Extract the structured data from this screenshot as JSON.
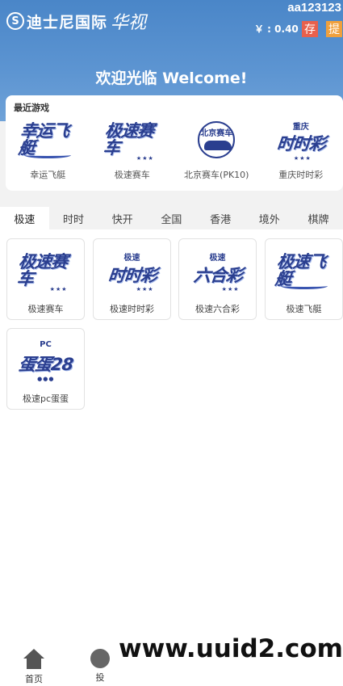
{
  "header": {
    "logo_mark": "S",
    "logo_text": "迪士尼国际",
    "logo_script": "华视",
    "username": "aa123123",
    "balance": "￥ : 0.40",
    "deposit_label": "存",
    "withdraw_label": "提",
    "welcome": "欢迎光临 Welcome!"
  },
  "recent": {
    "title": "最近游戏",
    "items": [
      {
        "label": "幸运飞艇",
        "logo": "幸运飞艇"
      },
      {
        "label": "极速赛车",
        "logo": "极速赛车"
      },
      {
        "label": "北京赛车(PK10)",
        "logo": "北京赛车"
      },
      {
        "label": "重庆时时彩",
        "logo": "时时彩",
        "logo_small": "重庆"
      }
    ]
  },
  "tabs": [
    "极速",
    "时时",
    "快开",
    "全国",
    "香港",
    "境外",
    "棋牌"
  ],
  "games": [
    {
      "label": "极速赛车",
      "logo": "极速赛车"
    },
    {
      "label": "极速时时彩",
      "logo": "时时彩",
      "logo_small": "极速"
    },
    {
      "label": "极速六合彩",
      "logo": "六合彩",
      "logo_small": "极速"
    },
    {
      "label": "极速飞艇",
      "logo": "极速飞艇"
    },
    {
      "label": "极速pc蛋蛋",
      "logo": "蛋蛋28",
      "logo_small": "PC"
    }
  ],
  "nav": {
    "home_label": "首页",
    "bet_label": "投"
  },
  "watermark": "www.uuid2.com",
  "colors": {
    "header": "#4a86c8",
    "deposit": "#e8604c",
    "withdraw": "#f0a03c",
    "logo_blue": "#2a3e8f"
  },
  "icons": {
    "home": "home-icon",
    "bet": "dice-icon"
  }
}
